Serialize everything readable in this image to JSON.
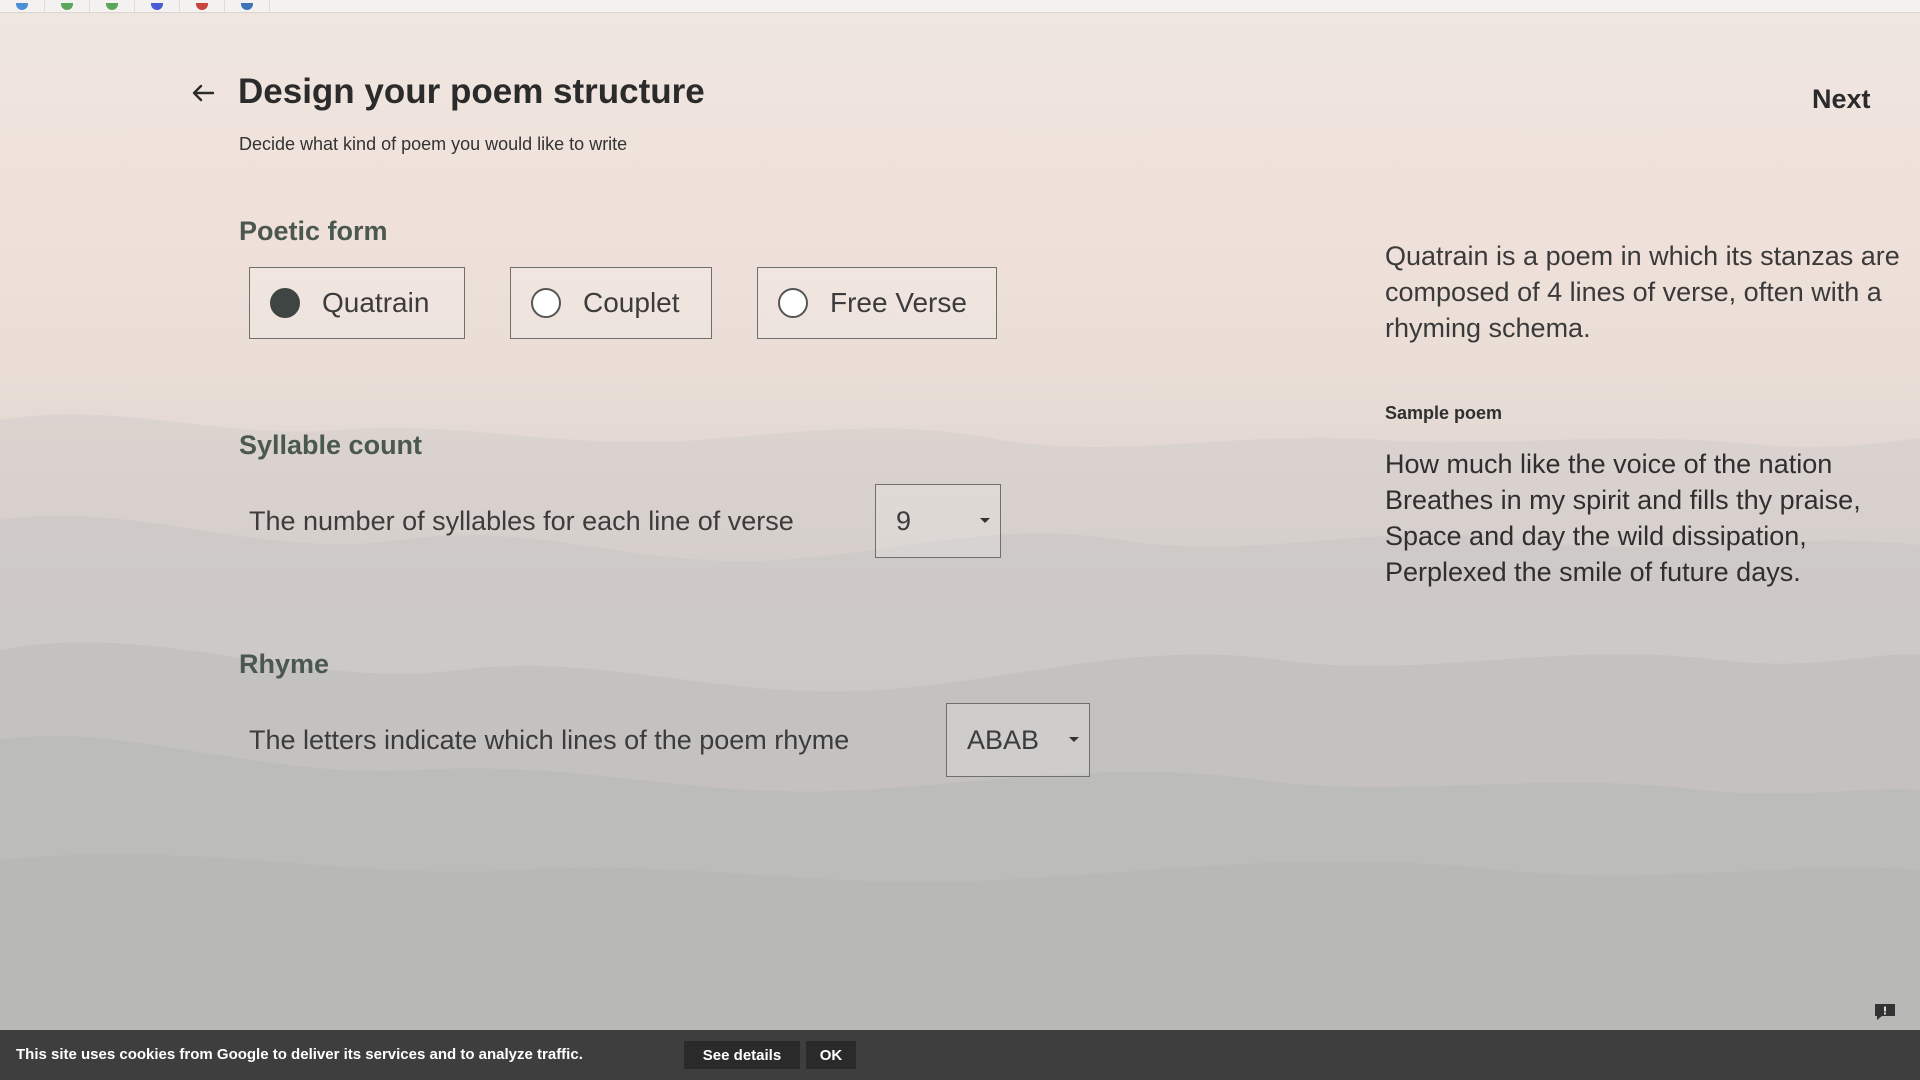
{
  "browser": {
    "url_fragment": "",
    "tab_icons": [
      "bird-icon",
      "leaf-icon",
      "leaf-icon",
      "shield-icon",
      "red-ball-icon",
      "house-icon"
    ]
  },
  "header": {
    "back_icon": "arrow-left-icon",
    "title": "Design your poem structure",
    "subtitle": "Decide what kind of poem you would like to write",
    "next_label": "Next"
  },
  "poetic_form": {
    "label": "Poetic form",
    "options": [
      {
        "label": "Quatrain",
        "selected": true
      },
      {
        "label": "Couplet",
        "selected": false
      },
      {
        "label": "Free Verse",
        "selected": false
      }
    ]
  },
  "syllable_count": {
    "label": "Syllable count",
    "description": "The number of syllables for each line of verse",
    "value": "9"
  },
  "rhyme": {
    "label": "Rhyme",
    "description": "The letters indicate which lines of the poem rhyme",
    "value": "ABAB"
  },
  "info": {
    "description": "Quatrain is a poem in which its stanzas are composed of 4 lines of verse, often with a rhyming schema.",
    "sample_label": "Sample poem",
    "sample_lines": [
      "How much like the voice of the nation",
      "Breathes in my spirit and fills thy praise,",
      "Space and day the wild dissipation,",
      "Perplexed the smile of future days."
    ]
  },
  "cookie_bar": {
    "text": "This site uses cookies from Google to deliver its services and to analyze traffic.",
    "details_label": "See details",
    "ok_label": "OK"
  },
  "colors": {
    "accent": "#4a5850",
    "cookie_bg": "#3e3e3e"
  }
}
